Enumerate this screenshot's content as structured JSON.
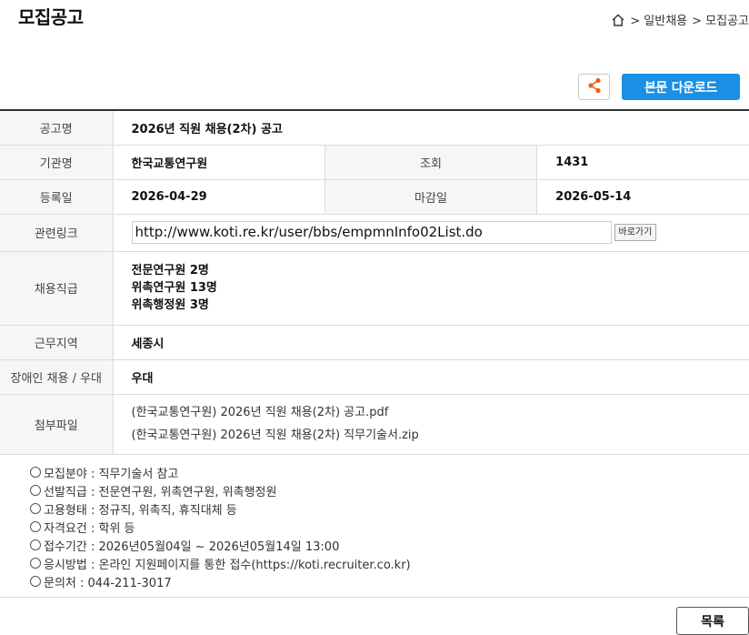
{
  "page": {
    "title": "모집공고"
  },
  "breadcrumb": {
    "items": [
      "> 일반채용",
      "> 모집공고"
    ]
  },
  "toolbar": {
    "download_label": "본문 다운로드",
    "share_icon": "share-icon"
  },
  "info": {
    "title_label": "공고명",
    "title_value": "2026년 직원 채용(2차) 공고",
    "org_label": "기관명",
    "org_value": "한국교통연구원",
    "views_label": "조회",
    "views_value": "1431",
    "reg_label": "등록일",
    "reg_value": "2026-04-29",
    "deadline_label": "마감일",
    "deadline_value": "2026-05-14",
    "link_label": "관련링크",
    "link_value": "http://www.koti.re.kr/user/bbs/empmnInfo02List.do",
    "link_button": "바로가기",
    "positions_label": "채용직급",
    "positions": [
      "전문연구원 2명",
      "위촉연구원 13명",
      "위촉행정원 3명"
    ],
    "region_label": "근무지역",
    "region_value": "세종시",
    "disabled_label": "장애인 채용 / 우대",
    "disabled_value": "우대",
    "attach_label": "첨부파일",
    "attachments": [
      "(한국교통연구원) 2026년 직원 채용(2차) 공고.pdf",
      "(한국교통연구원) 2026년 직원 채용(2차) 직무기술서.zip"
    ]
  },
  "notes": [
    "모집분야 : 직무기술서 참고",
    "선발직급 : 전문연구원, 위촉연구원, 위촉행정원",
    "고용형태 : 정규직, 위촉직, 휴직대체 등",
    "자격요건 : 학위 등",
    "접수기간 : 2026년05월04일 ~ 2026년05월14일 13:00",
    "응시방법 : 온라인 지원페이지를 통한 접수(https://koti.recruiter.co.kr)",
    "문의처 : 044-211-3017"
  ],
  "footer": {
    "list_label": "목록"
  },
  "colors": {
    "accent": "#1a8fe3",
    "share_icon": "#e8611c"
  }
}
